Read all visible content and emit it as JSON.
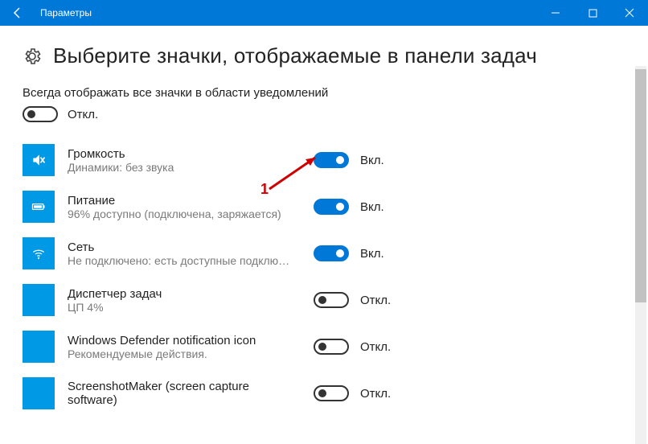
{
  "window": {
    "title": "Параметры"
  },
  "page": {
    "heading": "Выберите значки, отображаемые в панели задач",
    "always_show_label": "Всегда отображать все значки в области уведомлений",
    "master_state_label": "Откл.",
    "on_label": "Вкл.",
    "off_label": "Откл."
  },
  "items": [
    {
      "title": "Громкость",
      "sub": "Динамики: без звука",
      "on": true,
      "icon": "volume"
    },
    {
      "title": "Питание",
      "sub": "96% доступно (подключена, заряжается)",
      "on": true,
      "icon": "battery"
    },
    {
      "title": "Сеть",
      "sub": "Не подключено: есть доступные подклю…",
      "on": true,
      "icon": "wifi"
    },
    {
      "title": "Диспетчер задач",
      "sub": "ЦП 4%",
      "on": false,
      "icon": "blank"
    },
    {
      "title": "Windows Defender notification icon",
      "sub": "Рекомендуемые действия.",
      "on": false,
      "icon": "blank"
    },
    {
      "title": "ScreenshotMaker (screen capture software)",
      "sub": "",
      "on": false,
      "icon": "blank"
    }
  ],
  "annotation": {
    "label": "1"
  }
}
